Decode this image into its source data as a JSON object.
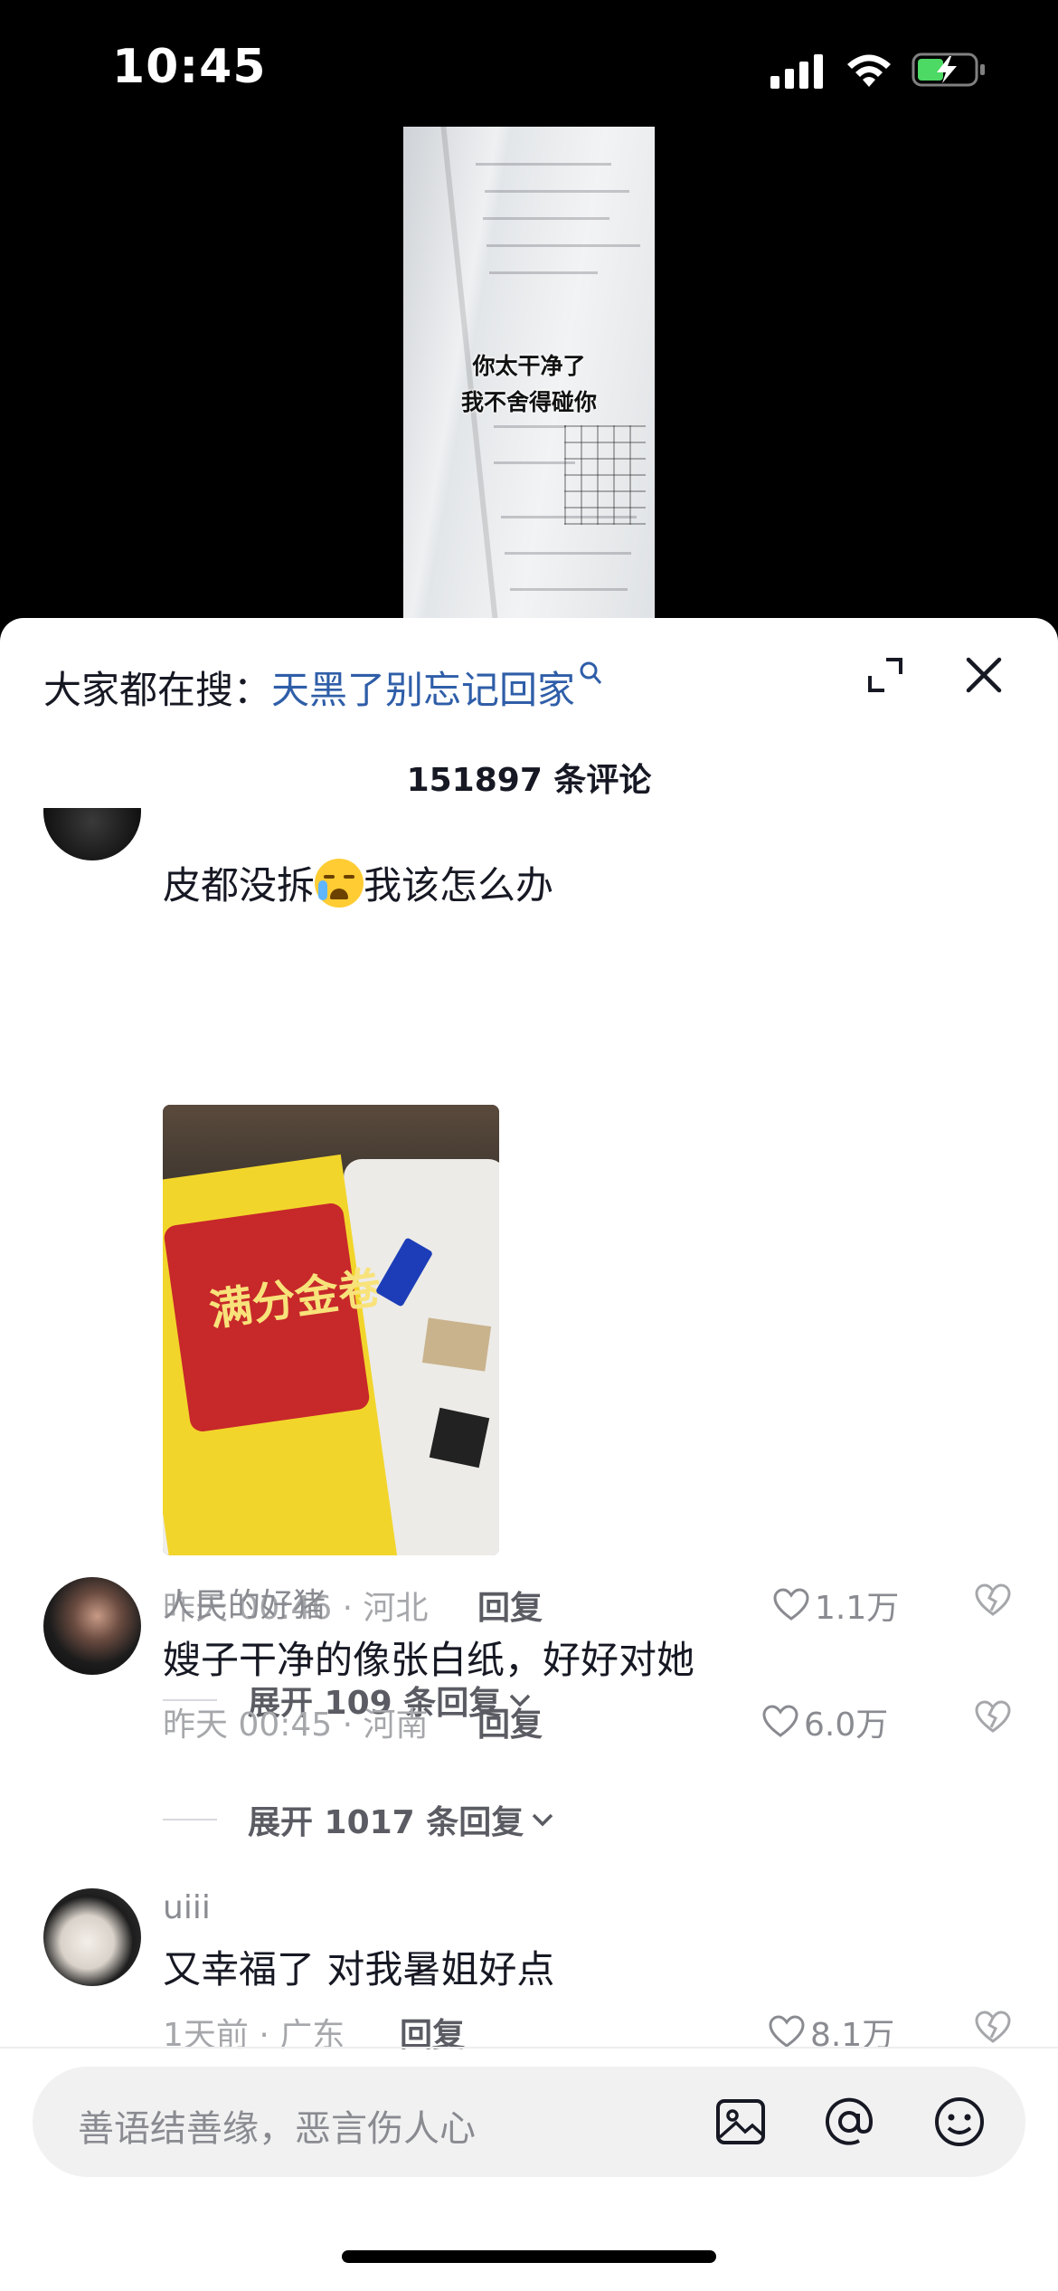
{
  "status_bar": {
    "time": "10:45",
    "battery_state": "charging",
    "icons": [
      "signal-icon",
      "wifi-icon",
      "battery-icon"
    ]
  },
  "video": {
    "caption_line1": "你太干净了",
    "caption_line2": "我不舍得碰你"
  },
  "sheet": {
    "search_prefix": "大家都在搜：",
    "search_term": "天黑了别忘记回家",
    "comment_count": "151897 条评论"
  },
  "comments": [
    {
      "username": "",
      "text_before_emoji": "皮都没拆",
      "emoji": "loudly-crying-face",
      "text_after_emoji": "我该怎么办",
      "photo_text": "满分金卷",
      "meta": "昨天 00:46 · 河北",
      "reply_label": "回复",
      "likes": "1.1万",
      "expand_label": "展开 109 条回复"
    },
    {
      "username": "人民的好猪",
      "text": "嫂子干净的像张白纸，好好对她",
      "meta": "昨天 00:45 · 河南",
      "reply_label": "回复",
      "likes": "6.0万",
      "expand_label": "展开 1017 条回复"
    },
    {
      "username": "uiii",
      "text": "又幸福了 对我暑姐好点",
      "meta": "1天前 · 广东",
      "reply_label": "回复",
      "likes": "8.1万"
    }
  ],
  "input": {
    "placeholder": "善语结善缘，恶言伤人心"
  },
  "colors": {
    "accent_link": "#2f5ea8",
    "text_primary": "#161823",
    "text_secondary": "#8a8b91",
    "sheet_bg": "#ffffff"
  }
}
